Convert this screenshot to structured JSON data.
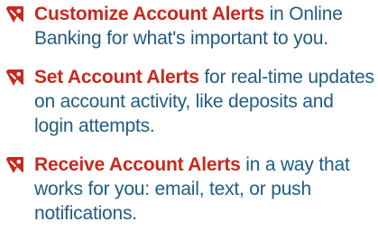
{
  "colors": {
    "accent_red": "#c8281d",
    "body_blue": "#1f5c82"
  },
  "alerts": [
    {
      "icon": "tag-icon",
      "title": "Customize Account Alerts",
      "description": " in Online Banking for what's important to you."
    },
    {
      "icon": "tag-icon",
      "title": "Set Account Alerts",
      "description": " for real-time updates on account activity, like deposits and login attempts."
    },
    {
      "icon": "tag-icon",
      "title": "Receive Account Alerts",
      "description": " in a way that works for you: email, text, or push notifications."
    }
  ]
}
